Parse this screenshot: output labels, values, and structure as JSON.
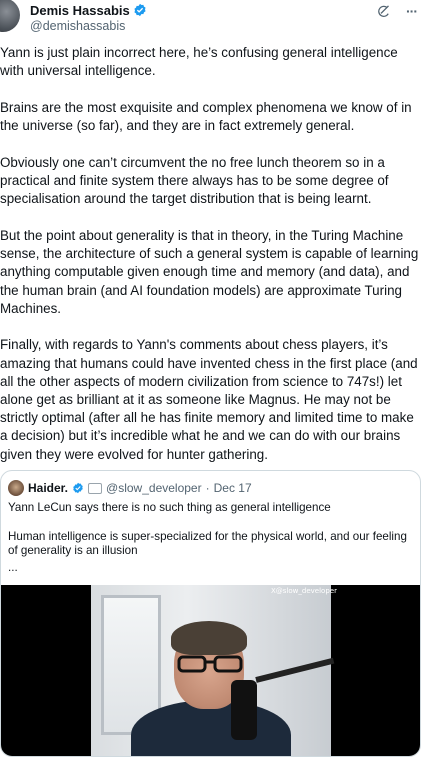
{
  "author": {
    "name": "Demis Hassabis",
    "handle": "@demishassabis"
  },
  "icons": {
    "verified": "verified-badge-icon",
    "grok": "grok-icon",
    "more": "more-icon"
  },
  "post": {
    "paragraphs": [
      "Yann is just plain incorrect here, he’s confusing general intelligence with universal intelligence.",
      "Brains are the most exquisite and complex phenomena we know of in the universe (so far), and they are in fact extremely general.",
      "Obviously one can’t circumvent the no free lunch theorem so in a practical and finite system there always has to be some degree of specialisation around the target distribution that is being learnt.",
      "But the point about generality is that in theory, in the Turing Machine sense, the architecture of such a general system is capable of learning anything computable given enough time and memory (and data), and the human brain (and AI foundation models) are approximate Turing Machines.",
      "Finally, with regards to Yann's comments about chess players, it’s amazing that humans could have invented chess in the first place (and all the other aspects of modern civilization from science to 747s!) let alone get as brilliant at it as someone like Magnus. He may not be strictly optimal (after all he has finite memory and limited time to make a decision) but it’s incredible what he and we can do with our brains given they were evolved for hunter gathering."
    ]
  },
  "quoted": {
    "name": "Haider.",
    "handle": "@slow_developer",
    "separator": "·",
    "date": "Dec 17",
    "text": [
      "Yann LeCun says there is no such thing as general intelligence",
      "Human intelligence is super-specialized for the physical world, and our feeling of generality is an illusion"
    ],
    "ellipsis": "...",
    "video_watermark": "X@slow_developer"
  },
  "colors": {
    "verified_blue": "#1d9bf0",
    "text_primary": "#0f1419",
    "text_secondary": "#536471",
    "border": "#cfd9de"
  }
}
